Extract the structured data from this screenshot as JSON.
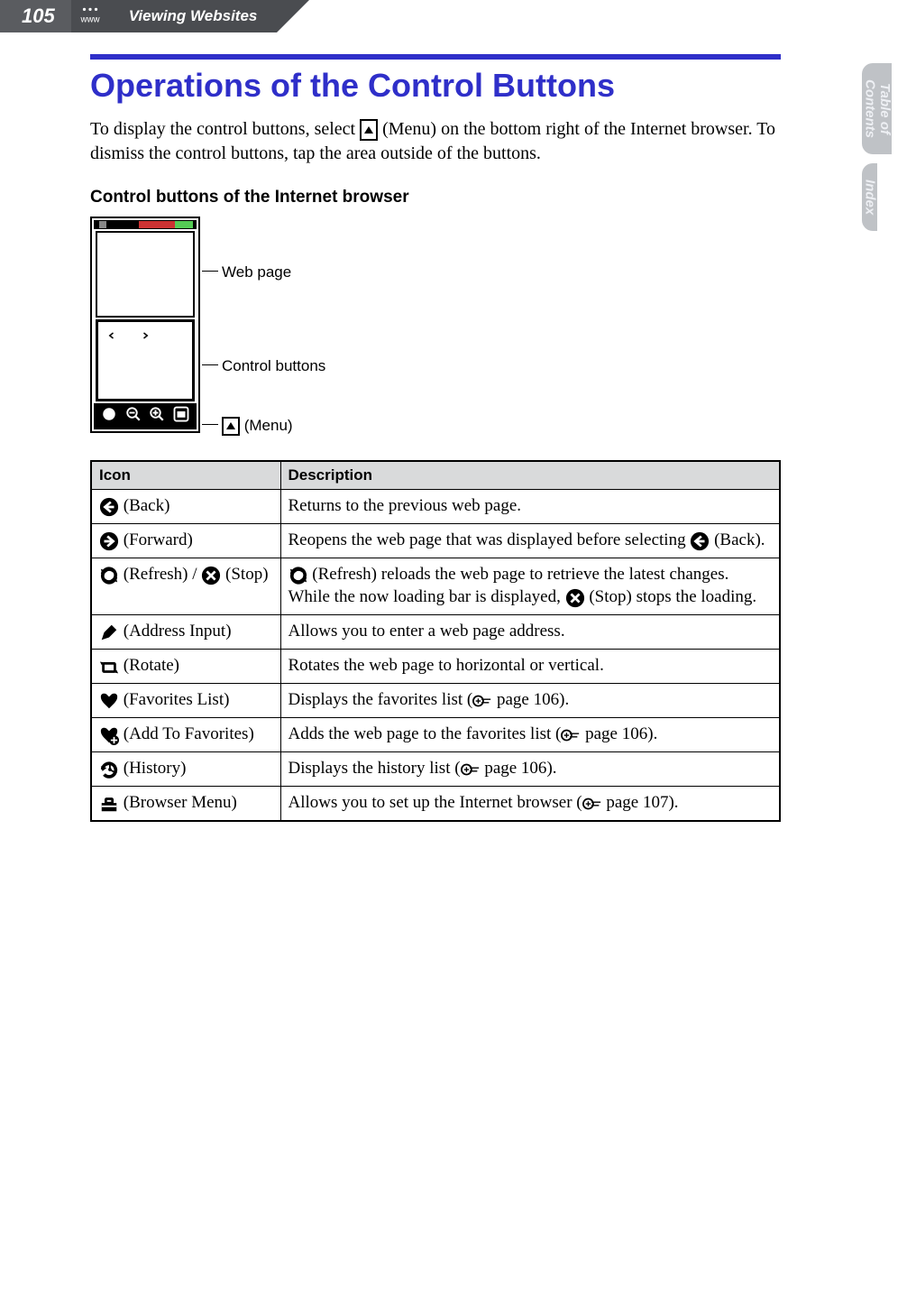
{
  "header": {
    "page_number": "105",
    "section_title": "Viewing Websites"
  },
  "side_tabs": {
    "toc_line1": "Table of",
    "toc_line2": "Contents",
    "index": "Index"
  },
  "title": "Operations of the Control Buttons",
  "intro": {
    "before_icon": "To display the control buttons, select ",
    "menu_label": " (Menu) on the bottom right of the Internet browser. To dismiss the control buttons, tap the area outside of the buttons."
  },
  "subheading": "Control buttons of the Internet browser",
  "diagram": {
    "web_label": "Web page",
    "ctrl_label": "Control buttons",
    "menu_label": " (Menu)"
  },
  "table": {
    "headers": {
      "icon": "Icon",
      "desc": "Description"
    },
    "rows": [
      {
        "icon_name": "back-icon",
        "icon_label": " (Back)",
        "desc": {
          "text": "Returns to the previous web page."
        }
      },
      {
        "icon_name": "forward-icon",
        "icon_label": " (Forward)",
        "desc": {
          "before": "Reopens the web page that was displayed before selecting ",
          "icon2": "back-icon",
          "after": " (Back)."
        }
      },
      {
        "icon_name": "refresh-stop-icon",
        "icon_label_refresh": " (Refresh) / ",
        "icon_label_stop": " (Stop)",
        "desc": {
          "p1_before_icon1": "",
          "icon1": "refresh-icon",
          "p1_after_icon1": " (Refresh) reloads the web page to retrieve the latest changes. While the now loading bar is displayed, ",
          "icon2": "stop-icon",
          "p1_after_icon2": " (Stop) stops the loading."
        }
      },
      {
        "icon_name": "address-input-icon",
        "icon_label": " (Address Input)",
        "desc": {
          "text": "Allows you to enter a web page address."
        }
      },
      {
        "icon_name": "rotate-icon",
        "icon_label": " (Rotate)",
        "desc": {
          "text": "Rotates the web page to horizontal or vertical."
        }
      },
      {
        "icon_name": "favorites-list-icon",
        "icon_label": " (Favorites List)",
        "desc": {
          "before": "Displays the favorites list (",
          "ref": "page 106",
          "after": ")."
        }
      },
      {
        "icon_name": "add-favorites-icon",
        "icon_label": " (Add To Favorites)",
        "desc": {
          "before": "Adds the web page to the favorites list (",
          "ref": "page 106",
          "after": ")."
        }
      },
      {
        "icon_name": "history-icon",
        "icon_label": " (History)",
        "desc": {
          "before": "Displays the history list (",
          "ref": "page 106",
          "after": ")."
        }
      },
      {
        "icon_name": "browser-menu-icon",
        "icon_label": " (Browser Menu)",
        "desc": {
          "before": "Allows you to set up the Internet browser (",
          "ref": "page 107",
          "after": ")."
        }
      }
    ]
  }
}
